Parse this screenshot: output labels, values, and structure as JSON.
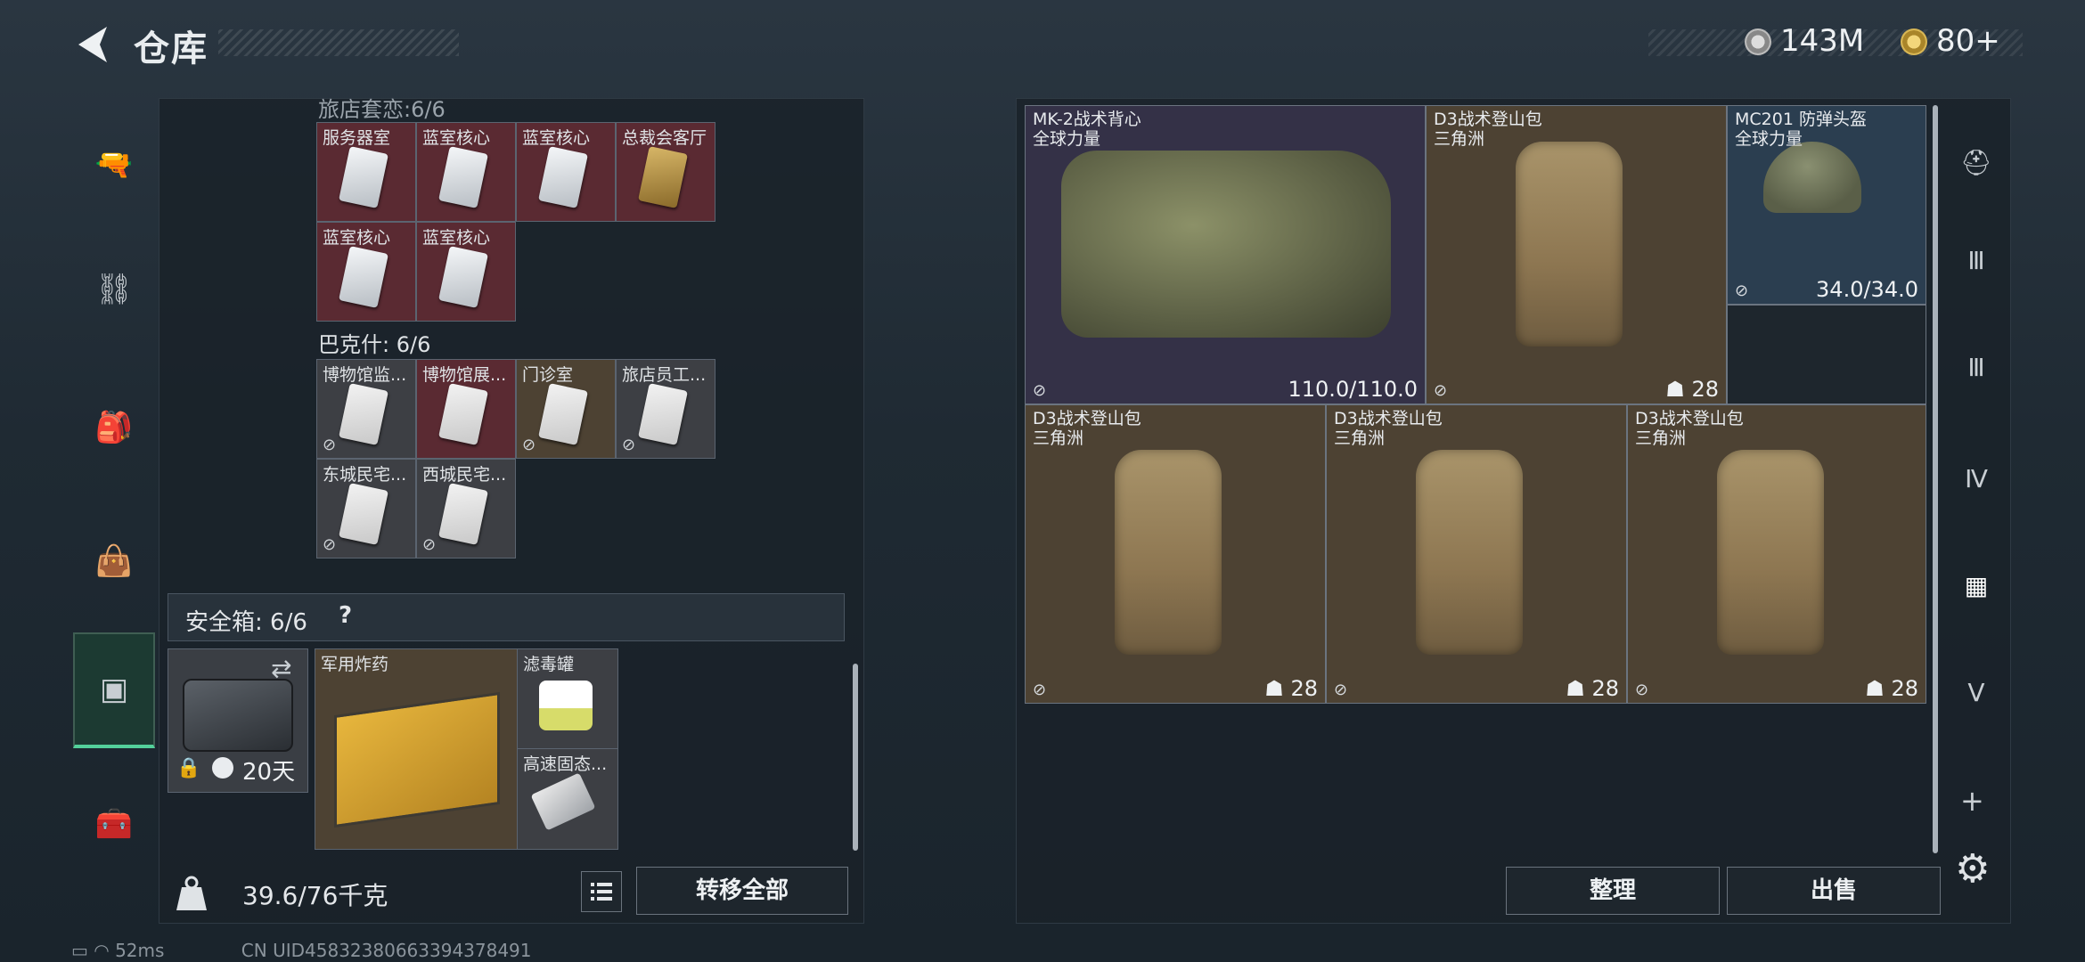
{
  "header": {
    "title": "仓库"
  },
  "currency": [
    {
      "icon": "silver-coin-icon",
      "value": "143M"
    },
    {
      "icon": "gold-coin-icon",
      "value": "80+"
    }
  ],
  "leftnav": {
    "items": [
      "pistol-icon",
      "vest-icon",
      "backpack-icon",
      "bag-icon",
      "case-icon",
      "toolbox-icon"
    ]
  },
  "inventory": {
    "group_top_label": "旅店套恋:6/6",
    "group_top": [
      "服务器室",
      "蓝室核心",
      "蓝室核心",
      "总裁会客厅",
      "蓝室核心",
      "蓝室核心"
    ],
    "group2_label": "巴克什: 6/6",
    "group2": [
      "博物馆监...",
      "博物馆展...",
      "门诊室",
      "旅店员工...",
      "东城民宅...",
      "西城民宅..."
    ]
  },
  "safebox": {
    "label": "安全箱: 6/6",
    "help": "?",
    "timer": "20天",
    "items": [
      "军用炸药",
      "滤毒罐",
      "高速固态..."
    ]
  },
  "weight": {
    "value": "39.6/76千克"
  },
  "buttons": {
    "transfer_all": "转移全部",
    "sort": "整理",
    "sell": "出售"
  },
  "stash": [
    {
      "name": "MK-2战术背心",
      "sub": "全球力量",
      "value": "110.0/110.0"
    },
    {
      "name": "D3战术登山包",
      "sub": "三角洲",
      "value": "28"
    },
    {
      "name": "MC201 防弹头盔",
      "sub": "全球力量",
      "value": "34.0/34.0"
    },
    {
      "name": "D3战术登山包",
      "sub": "三角洲",
      "value": "28"
    },
    {
      "name": "D3战术登山包",
      "sub": "三角洲",
      "value": "28"
    },
    {
      "name": "D3战术登山包",
      "sub": "三角洲",
      "value": "28"
    }
  ],
  "rightnav": {
    "items": [
      "helmet-slot-icon",
      "tier3-icon",
      "tier3b-icon",
      "tier4-icon",
      "tier4-active-icon",
      "tier5-icon"
    ]
  },
  "status": {
    "ping": "52ms",
    "uid": "CN UID45832380663394378491"
  }
}
